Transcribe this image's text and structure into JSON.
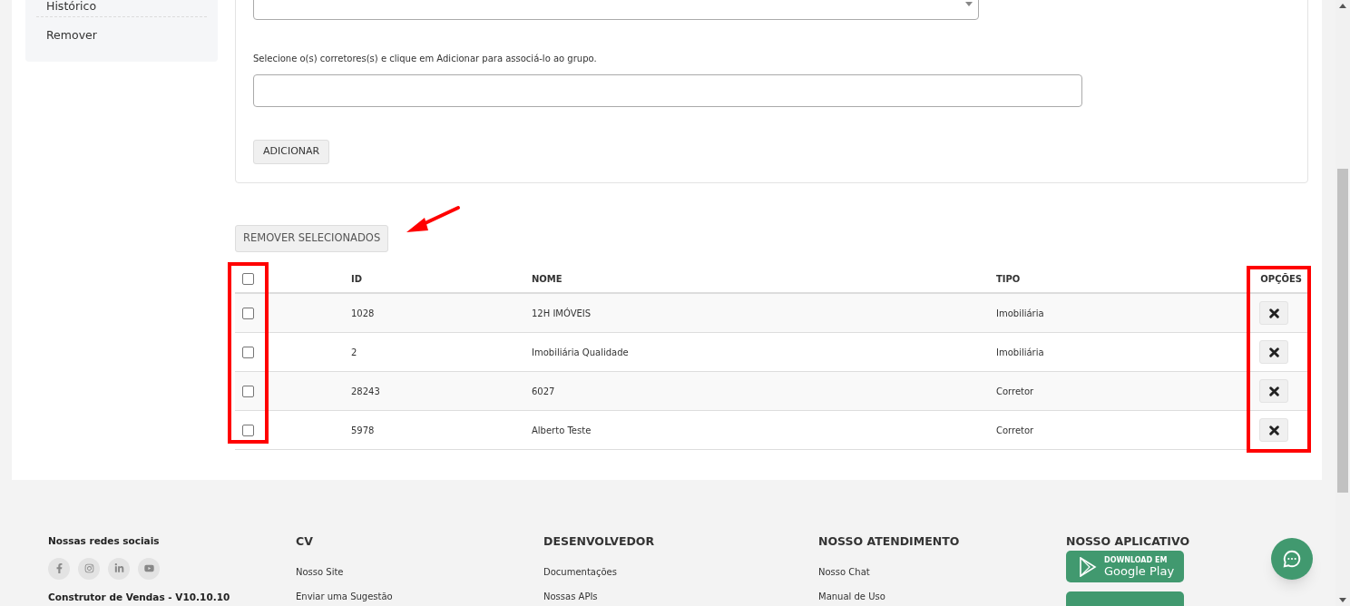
{
  "sidebar": {
    "items": [
      {
        "label": "Histórico"
      },
      {
        "label": "Remover"
      }
    ]
  },
  "add_panel": {
    "instruction": "Selecione o(s) corretores(s) e clique em Adicionar para associá-lo ao grupo.",
    "add_button": "ADICIONAR"
  },
  "remove_selected_button": "REMOVER SELECIONADOS",
  "table": {
    "select_all": {
      "checked": false
    },
    "columns": [
      "ID",
      "NOME",
      "TIPO",
      "OPÇÕES"
    ],
    "rows": [
      {
        "checked": false,
        "id": "1028",
        "nome": "12H IMÓVEIS",
        "tipo": "Imobiliária"
      },
      {
        "checked": false,
        "id": "2",
        "nome": "Imobiliária Qualidade",
        "tipo": "Imobiliária"
      },
      {
        "checked": false,
        "id": "28243",
        "nome": "6027",
        "tipo": "Corretor"
      },
      {
        "checked": false,
        "id": "5978",
        "nome": "Alberto Teste",
        "tipo": "Corretor"
      }
    ]
  },
  "footer": {
    "social_title": "Nossas redes sociais",
    "social": [
      {
        "kind": "facebook"
      },
      {
        "kind": "instagram"
      },
      {
        "kind": "linkedin"
      },
      {
        "kind": "youtube"
      }
    ],
    "version": "Construtor de Vendas - V10.10.10",
    "columns": [
      {
        "title": "CV",
        "links": [
          "Nosso Site",
          "Enviar uma Sugestão"
        ]
      },
      {
        "title": "DESENVOLVEDOR",
        "links": [
          "Documentações",
          "Nossas APIs"
        ]
      },
      {
        "title": "NOSSO ATENDIMENTO",
        "links": [
          "Nosso Chat",
          "Manual de Uso"
        ]
      }
    ],
    "app": {
      "title": "NOSSO APLICATIVO",
      "badges": [
        {
          "kind": "google_play",
          "small": "DOWNLOAD EM",
          "big": "Google Play"
        },
        {
          "kind": "app_store"
        }
      ]
    }
  }
}
